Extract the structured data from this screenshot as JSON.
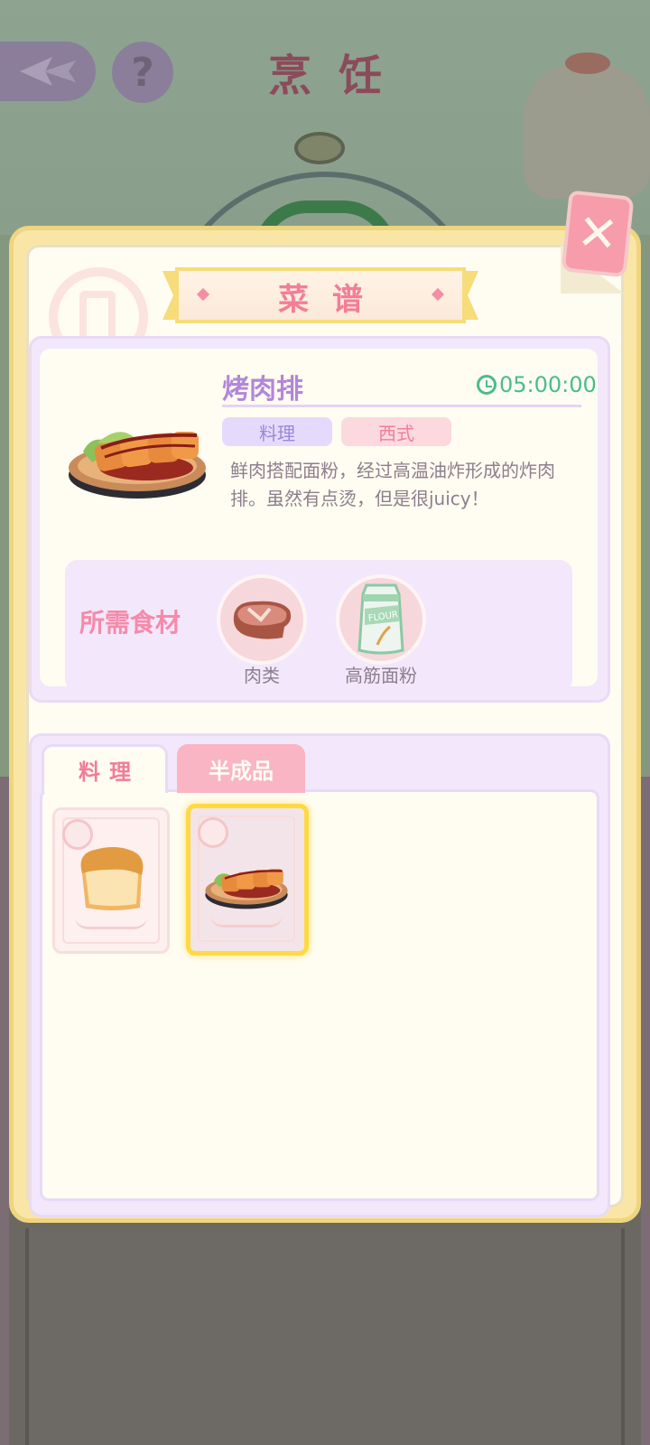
{
  "scene": {
    "title": "烹饪"
  },
  "modal": {
    "title": "菜谱",
    "close_icon": "close-icon"
  },
  "recipe": {
    "name": "烤肉排",
    "time": "05:00:00",
    "tags": [
      "料理",
      "西式"
    ],
    "description": "鲜肉搭配面粉，经过高温油炸形成的炸肉排。虽然有点烫，但是很juicy！",
    "ingredients_label": "所需食材",
    "ingredients": [
      {
        "name": "肉类",
        "icon": "meat-icon"
      },
      {
        "name": "高筋面粉",
        "icon": "flour-bag-icon"
      }
    ]
  },
  "tabs": {
    "cook": "料理",
    "semi": "半成品"
  },
  "items": [
    {
      "icon": "bread-icon",
      "selected": false
    },
    {
      "icon": "fried-steak-icon",
      "selected": true
    }
  ],
  "colors": {
    "accent_pink": "#f27e97",
    "accent_purple": "#b287d9",
    "timer_green": "#49bc8d",
    "selected_border": "#ffd944"
  }
}
